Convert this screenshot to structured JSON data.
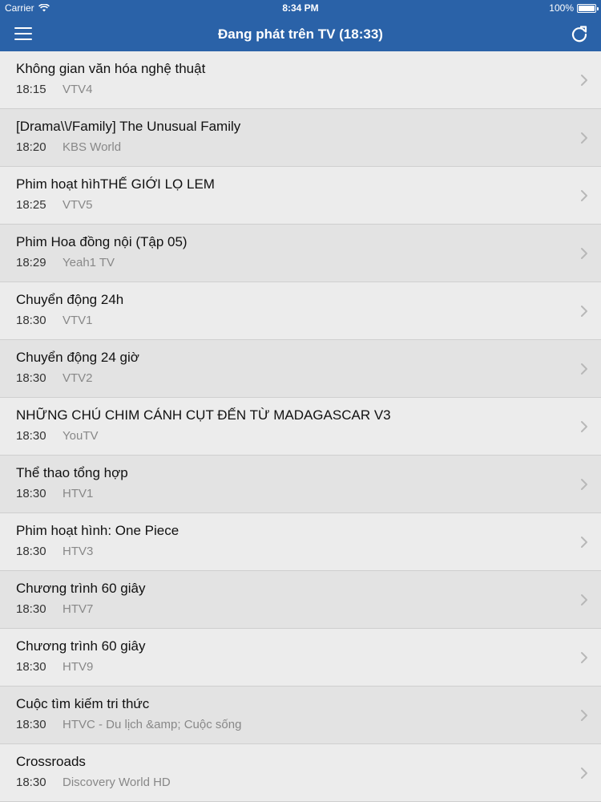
{
  "status_bar": {
    "carrier": "Carrier",
    "time": "8:34 PM",
    "battery": "100%",
    "battery_level": 1.0
  },
  "nav": {
    "title": "Đang phát trên TV (18:33)",
    "menu_icon": "hamburger-icon",
    "refresh_icon": "refresh-icon"
  },
  "programs": [
    {
      "title": "Không gian văn hóa nghệ thuật",
      "time": "18:15",
      "channel": "VTV4"
    },
    {
      "title": "[Drama\\\\/Family] The Unusual Family",
      "time": "18:20",
      "channel": "KBS World"
    },
    {
      "title": "Phim hoạt hìhTHẾ GIỚI LỌ LEM",
      "time": "18:25",
      "channel": "VTV5"
    },
    {
      "title": "Phim Hoa đồng nội (Tập 05)",
      "time": "18:29",
      "channel": "Yeah1 TV"
    },
    {
      "title": "Chuyển động 24h",
      "time": "18:30",
      "channel": "VTV1"
    },
    {
      "title": "Chuyển động 24 giờ",
      "time": "18:30",
      "channel": "VTV2"
    },
    {
      "title": "NHỮNG CHÚ CHIM CÁNH CỤT ĐẾN TỪ MADAGASCAR V3",
      "time": "18:30",
      "channel": "YouTV"
    },
    {
      "title": "Thể thao tổng hợp",
      "time": "18:30",
      "channel": "HTV1"
    },
    {
      "title": "Phim hoạt hình: One Piece",
      "time": "18:30",
      "channel": "HTV3"
    },
    {
      "title": "Chương trình 60 giây",
      "time": "18:30",
      "channel": "HTV7"
    },
    {
      "title": "Chương trình 60 giây",
      "time": "18:30",
      "channel": "HTV9"
    },
    {
      "title": "Cuộc tìm kiếm tri thức",
      "time": "18:30",
      "channel": "HTVC - Du lịch &amp; Cuộc sống"
    },
    {
      "title": "Crossroads",
      "time": "18:30",
      "channel": "Discovery World HD"
    }
  ],
  "colors": {
    "nav_bg": "#2a62a8",
    "row_bg": "#ececec",
    "row_alt_bg": "#e3e3e3",
    "channel_text": "#888888"
  }
}
